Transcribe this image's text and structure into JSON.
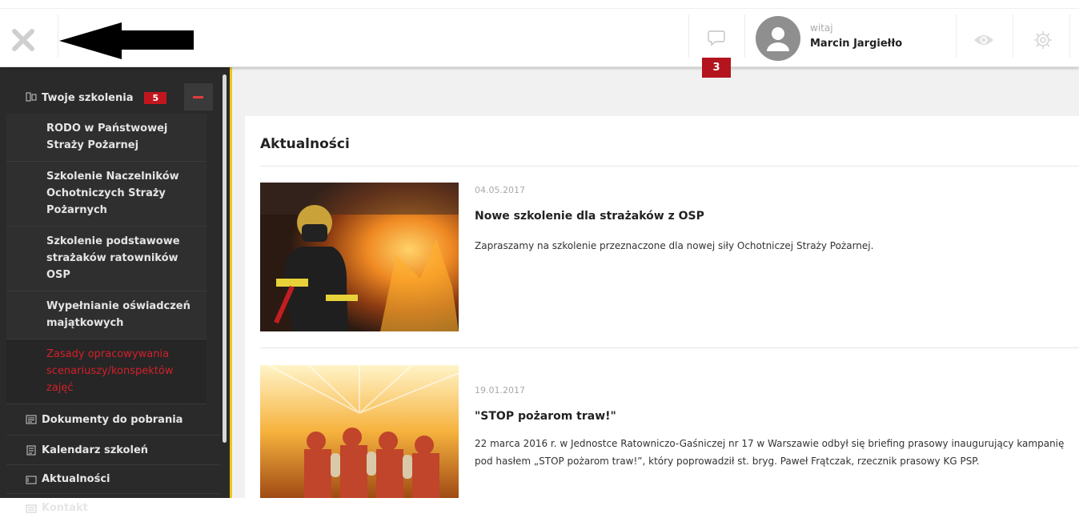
{
  "header": {
    "messages_count": "3",
    "greeting": "witaj",
    "user_name": "Marcin Jargiełło"
  },
  "sidebar": {
    "trainings": {
      "label": "Twoje szkolenia",
      "count": "5",
      "items": [
        {
          "label": "RODO w Państwowej Straży Pożarnej"
        },
        {
          "label": "Szkolenie Naczelników Ochotniczych Straży Pożarnych"
        },
        {
          "label": "Szkolenie podstawowe strażaków ratowników OSP"
        },
        {
          "label": "Wypełnianie oświadczeń majątkowych"
        },
        {
          "label": "Zasady opracowywania scenariuszy/konspektów zajęć"
        }
      ]
    },
    "items": [
      {
        "label": "Dokumenty do pobrania",
        "icon": "document-download-icon"
      },
      {
        "label": "Kalendarz szkoleń",
        "icon": "calendar-icon"
      },
      {
        "label": "Aktualności",
        "icon": "news-icon"
      },
      {
        "label": "Kontakt",
        "icon": "contact-icon"
      }
    ]
  },
  "main": {
    "title": "Aktualności",
    "news": [
      {
        "date": "04.05.2017",
        "title": "Nowe szkolenie dla strażaków z OSP",
        "text": "Zapraszamy na szkolenie przeznaczone dla nowej siły Ochotniczej Straży Pożarnej.",
        "image": "firefighter-fire-image"
      },
      {
        "date": "19.01.2017",
        "title": "\"STOP pożarom traw!\"",
        "text": "22 marca 2016 r. w Jednostce Ratowniczo-Gaśniczej nr 17 w Warszawie odbył się briefing prasowy inaugurujący kampanię pod hasłem „STOP pożarom traw!”, który poprowadził st. bryg. Paweł Frątczak, rzecznik prasowy KG PSP.",
        "image": "firefighters-hoses-image"
      }
    ]
  },
  "colors": {
    "accent_red": "#c2161f",
    "sidebar_bg": "#2a2a2a",
    "sidebar_accent": "#f0c419"
  }
}
